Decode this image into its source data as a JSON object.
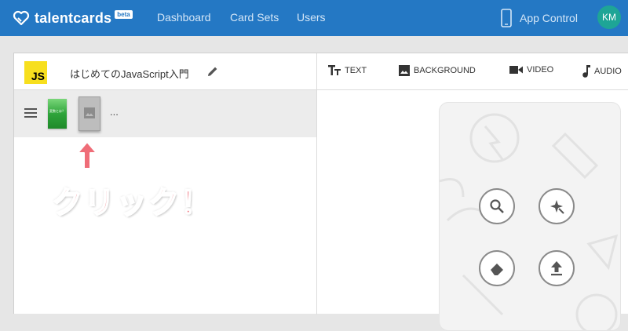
{
  "topbar": {
    "brand_name": "talentcards",
    "brand_badge": "beta",
    "nav": [
      "Dashboard",
      "Card Sets",
      "Users"
    ],
    "app_control_label": "App Control",
    "avatar_initials": "KM",
    "background_color": "#2478c4"
  },
  "set_header": {
    "logo_text": "JS",
    "title": "はじめてのJavaScript入門"
  },
  "card_strip": {
    "thumb1_text": "変数とは？",
    "ellipsis": "..."
  },
  "toolbar": {
    "text_label": "TEXT",
    "background_label": "BACKGROUND",
    "video_label": "VIDEO",
    "audio_label": "AUDIO"
  },
  "card_actions": [
    "search-icon",
    "magic-icon",
    "eraser-icon",
    "upload-icon"
  ],
  "annotation": {
    "arrow": "↑",
    "text": "クリック！",
    "color": "#ef6d78"
  }
}
